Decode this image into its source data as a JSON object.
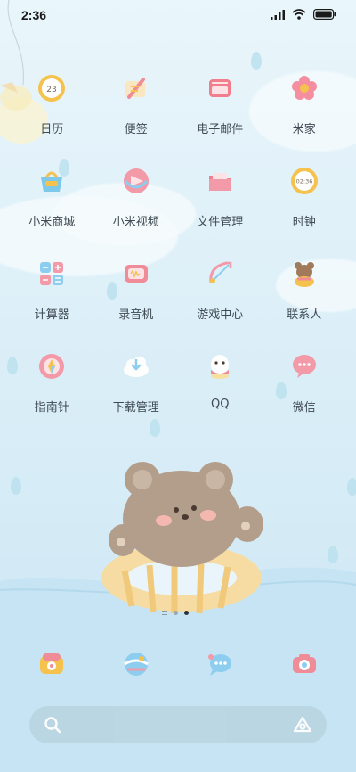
{
  "status": {
    "time": "2:36"
  },
  "apps": [
    {
      "label": "日历",
      "icon": "calendar-icon",
      "badge": "23",
      "color": "#f4c24d"
    },
    {
      "label": "便签",
      "icon": "notes-icon",
      "color": "#f2a0a8"
    },
    {
      "label": "电子邮件",
      "icon": "email-icon",
      "color": "#f07e8c"
    },
    {
      "label": "米家",
      "icon": "mihome-icon",
      "color": "#f58fa0"
    },
    {
      "label": "小米商城",
      "icon": "mi-store-icon",
      "color": "#7ec8ea"
    },
    {
      "label": "小米视频",
      "icon": "mi-video-icon",
      "color": "#f29aa8"
    },
    {
      "label": "文件管理",
      "icon": "file-manager-icon",
      "color": "#f07e8c"
    },
    {
      "label": "时钟",
      "icon": "clock-icon",
      "badge": "02:36",
      "color": "#f4c24d"
    },
    {
      "label": "计算器",
      "icon": "calculator-icon",
      "color": "#8ccdf0"
    },
    {
      "label": "录音机",
      "icon": "recorder-icon",
      "color": "#f08b98"
    },
    {
      "label": "游戏中心",
      "icon": "game-center-icon",
      "color": "#f29aa8"
    },
    {
      "label": "联系人",
      "icon": "contacts-icon",
      "color": "#a07a5a"
    },
    {
      "label": "指南针",
      "icon": "compass-icon",
      "color": "#f29aa8"
    },
    {
      "label": "下载管理",
      "icon": "download-icon",
      "color": "#8ccdf0"
    },
    {
      "label": "QQ",
      "icon": "qq-icon",
      "color": "#f6e0a0"
    },
    {
      "label": "微信",
      "icon": "wechat-icon",
      "color": "#f29aa8"
    }
  ],
  "dock": [
    {
      "icon": "phone-icon",
      "color": "#f4c24d"
    },
    {
      "icon": "browser-icon",
      "color": "#8ccdf0"
    },
    {
      "icon": "messages-icon",
      "color": "#8ccdf0"
    },
    {
      "icon": "camera-icon",
      "color": "#f08b98"
    }
  ],
  "page_indicator": {
    "pages": 2,
    "current": 2
  }
}
